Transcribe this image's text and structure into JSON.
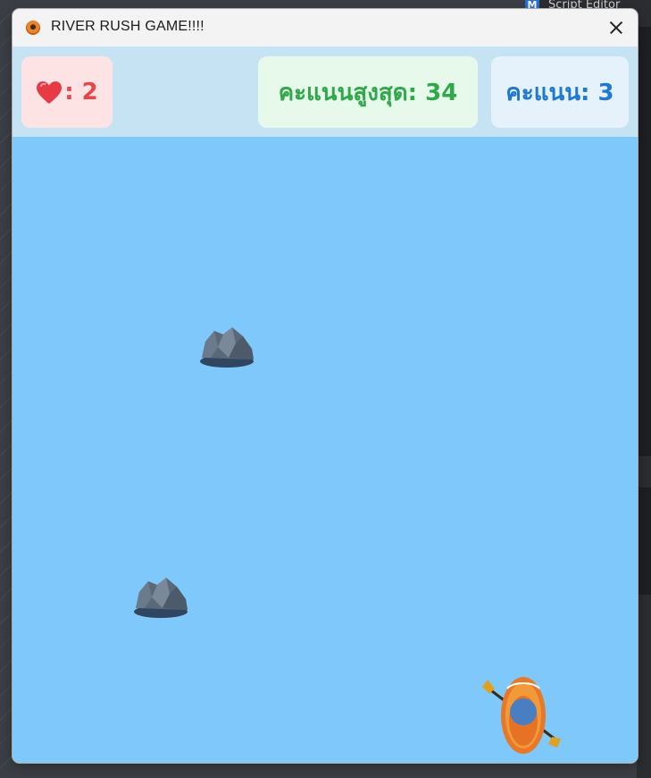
{
  "window": {
    "title": "RIVER RUSH GAME!!!!",
    "app_icon": "boat-game-icon",
    "close_icon": "close-icon"
  },
  "hud": {
    "lives_icon": "heart-icon",
    "lives_text": ": 2",
    "high_score_text": "คะแนนสูงสุด: 34",
    "score_text": "คะแนน: 3"
  },
  "colors": {
    "river": "#7fc8fc",
    "hud_background": "#c5e3f2",
    "lives": "#e8474a",
    "high_score": "#2fa84a",
    "score": "#1f78d1"
  },
  "scene": {
    "obstacles": [
      "rock",
      "rock"
    ],
    "player": "rowboat"
  },
  "background": {
    "editor_title": "Script Editor"
  }
}
